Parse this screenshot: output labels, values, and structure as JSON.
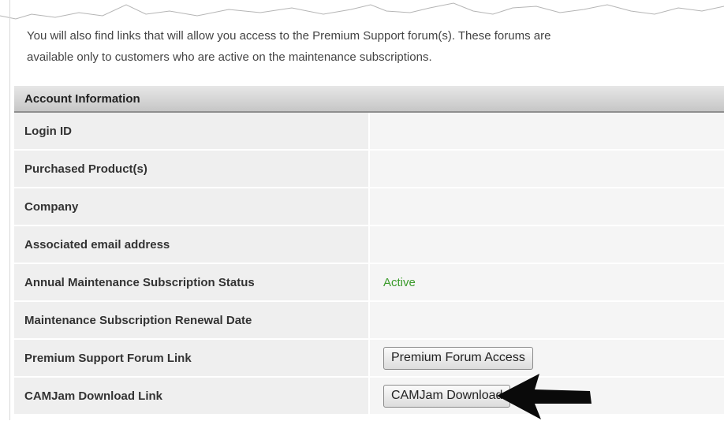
{
  "intro": {
    "line1": "You will also find links that will allow you access to the Premium Support forum(s).  These forums are",
    "line2": "available only to customers who are active on the maintenance subscriptions."
  },
  "account": {
    "header": "Account Information",
    "rows": [
      {
        "label": "Login ID",
        "value": ""
      },
      {
        "label": "Purchased Product(s)",
        "value": ""
      },
      {
        "label": "Company",
        "value": ""
      },
      {
        "label": "Associated email address",
        "value": ""
      },
      {
        "label": "Annual Maintenance Subscription Status",
        "value": "Active"
      },
      {
        "label": "Maintenance Subscription Renewal Date",
        "value": ""
      },
      {
        "label": "Premium Support Forum Link",
        "button": "Premium Forum Access"
      },
      {
        "label": "CAMJam Download Link",
        "button": "CAMJam Download"
      }
    ]
  },
  "colors": {
    "status_active": "#3a9a2a",
    "header_bg": "#d4d4d4",
    "label_bg": "#efefef",
    "value_bg": "#f5f5f5"
  },
  "icons": {
    "pointer": "left-arrow-icon"
  }
}
